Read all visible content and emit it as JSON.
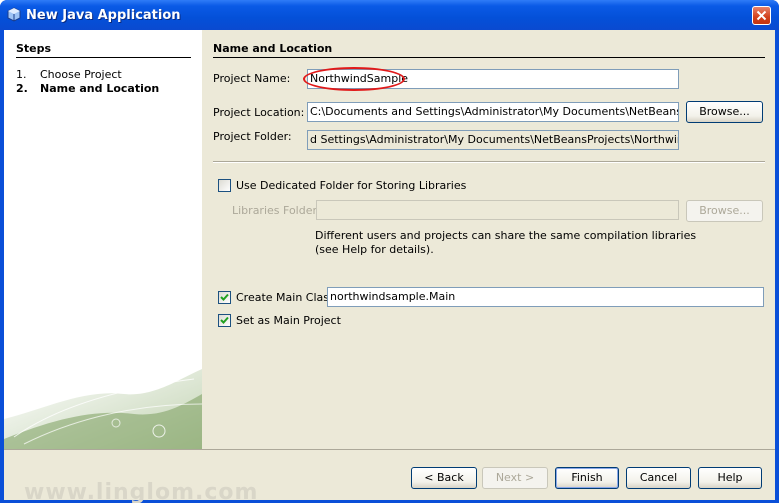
{
  "window": {
    "title": "New Java Application",
    "title_icon": "java-cup-icon",
    "close_icon": "close-icon"
  },
  "steps": {
    "heading": "Steps",
    "items": [
      {
        "num": "1.",
        "label": "Choose Project",
        "active": false
      },
      {
        "num": "2.",
        "label": "Name and Location",
        "active": true
      }
    ]
  },
  "main": {
    "heading": "Name and Location",
    "project_name": {
      "label": "Project Name:",
      "value": "NorthwindSample"
    },
    "project_location": {
      "label": "Project Location:",
      "value": "C:\\Documents and Settings\\Administrator\\My Documents\\NetBeansProjects",
      "browse": "Browse..."
    },
    "project_folder": {
      "label": "Project Folder:",
      "value": "d Settings\\Administrator\\My Documents\\NetBeansProjects\\NorthwindSample"
    },
    "dedicated_folder": {
      "label": "Use Dedicated Folder for Storing Libraries",
      "checked": false
    },
    "libraries_folder": {
      "label": "Libraries Folder:",
      "value": "",
      "browse": "Browse..."
    },
    "libraries_note": "Different users and projects can share the same compilation libraries (see Help for details).",
    "create_main_class": {
      "label": "Create Main Class",
      "checked": true,
      "value": "northwindsample.Main"
    },
    "set_main_project": {
      "label": "Set as Main Project",
      "checked": true
    }
  },
  "footer": {
    "back": "< Back",
    "next": "Next >",
    "finish": "Finish",
    "cancel": "Cancel",
    "help": "Help"
  },
  "watermark": "www.linglom.com",
  "colors": {
    "titlebar": "#0450d8",
    "highlight": "#e11a1a",
    "dialog_bg": "#ece9d8"
  }
}
